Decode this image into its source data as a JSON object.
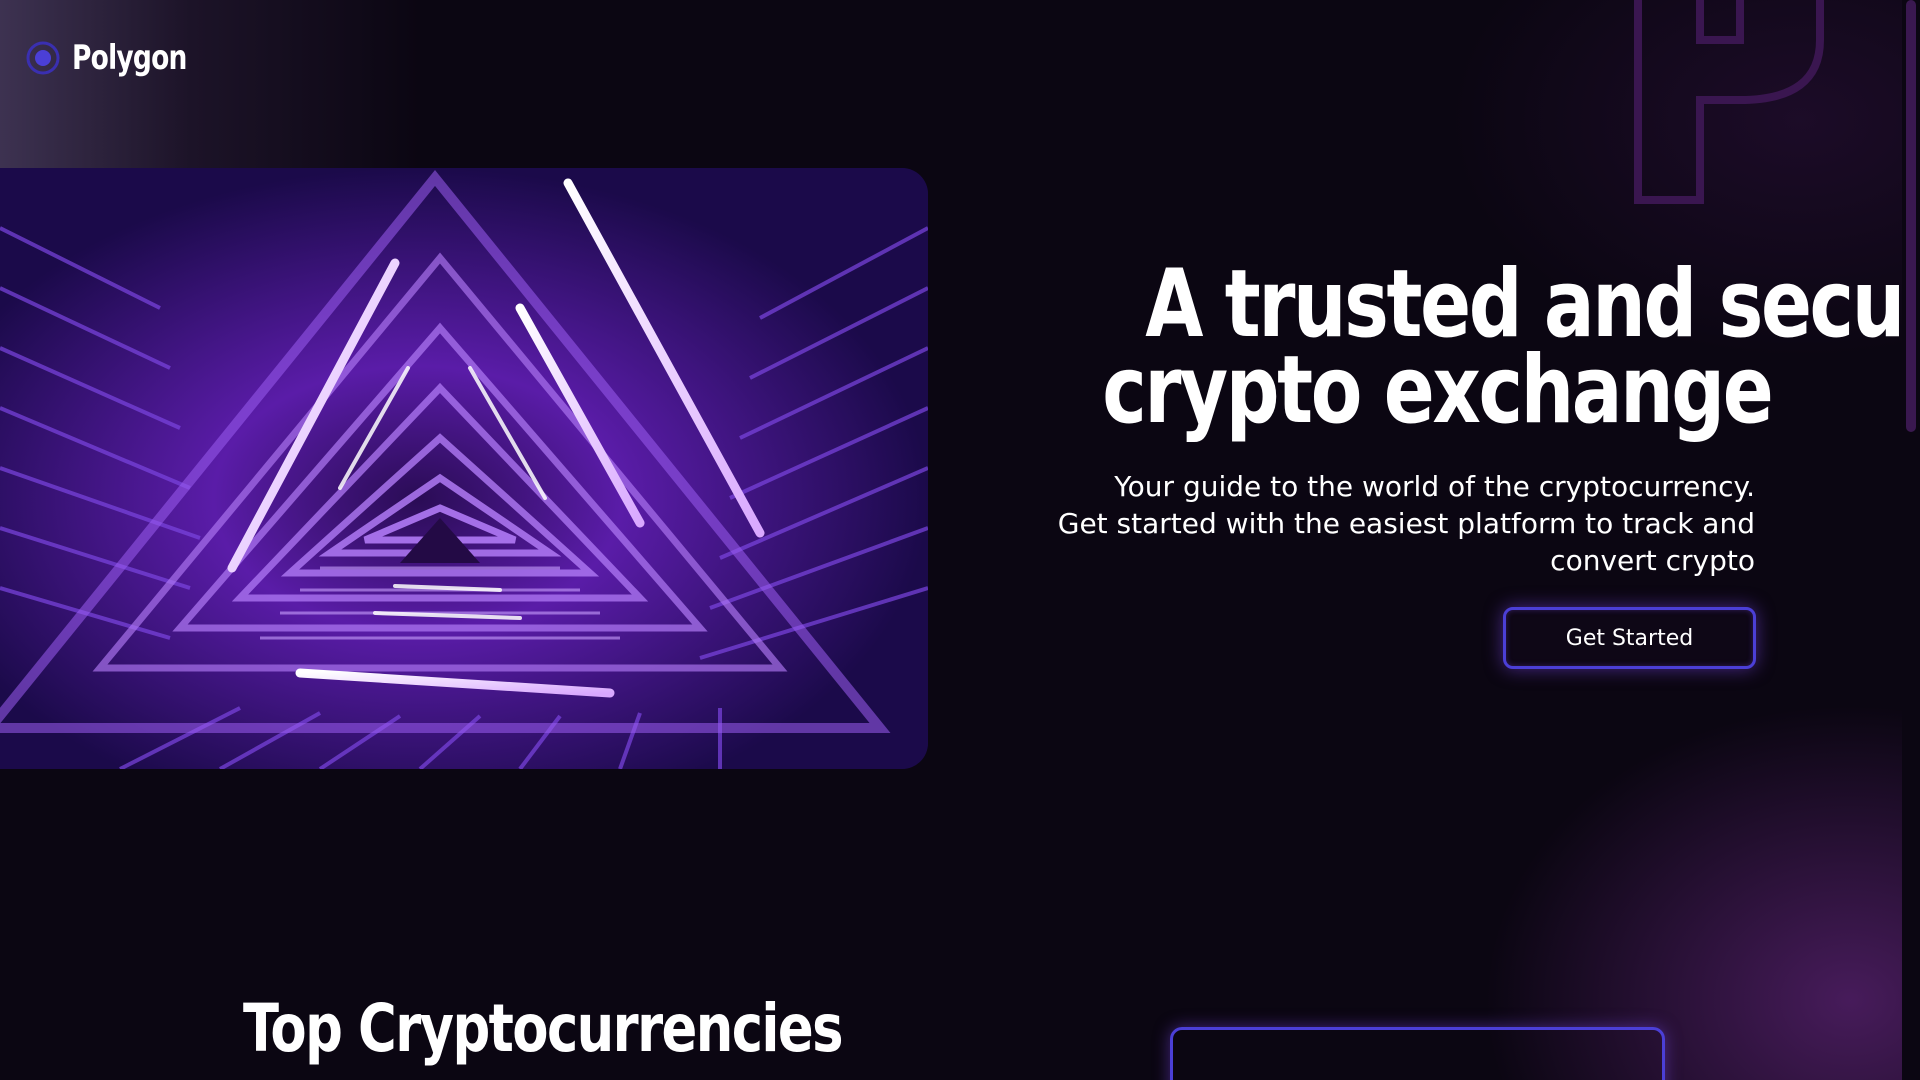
{
  "brand": {
    "name": "Polygon",
    "logo_icon": "polygon-logo-icon"
  },
  "hero": {
    "title_line1": "A trusted and secure",
    "title_line2": "crypto exchange",
    "subtitle_line1": "Your guide to the world of the cryptocurrency.",
    "subtitle_line2": "Get started with the easiest platform to track and",
    "subtitle_line3": "convert crypto",
    "cta_label": "Get Started",
    "image": "purple-neon-triangular-staircase"
  },
  "sections": {
    "top_crypto_title": "Top Cryptocurrencies"
  },
  "colors": {
    "background": "#0b0612",
    "accent": "#4b3fd6",
    "glow": "#7a46e6",
    "text": "#ffffff"
  }
}
